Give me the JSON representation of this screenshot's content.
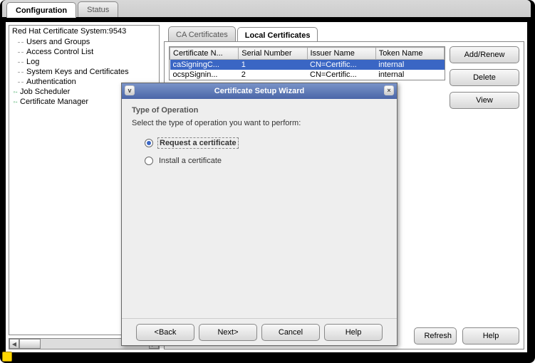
{
  "top_tabs": {
    "configuration": "Configuration",
    "status": "Status"
  },
  "tree": {
    "root": "Red Hat Certificate System:9543",
    "items": [
      "Users and Groups",
      "Access Control List",
      "Log",
      "System Keys and Certificates",
      "Authentication"
    ],
    "job_scheduler": "Job Scheduler",
    "cert_manager": "Certificate Manager"
  },
  "sub_tabs": {
    "ca": "CA Certificates",
    "local": "Local Certificates"
  },
  "table": {
    "headers": [
      "Certificate N...",
      "Serial Number",
      "Issuer Name",
      "Token Name"
    ],
    "rows": [
      [
        "caSigningC...",
        "1",
        "CN=Certific...",
        "internal"
      ],
      [
        "ocspSignin...",
        "2",
        "CN=Certific...",
        "internal"
      ]
    ]
  },
  "buttons": {
    "add_renew": "Add/Renew",
    "delete": "Delete",
    "view": "View",
    "refresh": "Refresh",
    "help": "Help"
  },
  "dialog": {
    "title": "Certificate Setup Wizard",
    "heading": "Type of Operation",
    "subtext": "Select the type of operation you want to perform:",
    "option_request": "Request a certificate",
    "option_install": "Install a certificate",
    "footer": {
      "back": "<Back",
      "next": "Next>",
      "cancel": "Cancel",
      "help": "Help"
    }
  }
}
